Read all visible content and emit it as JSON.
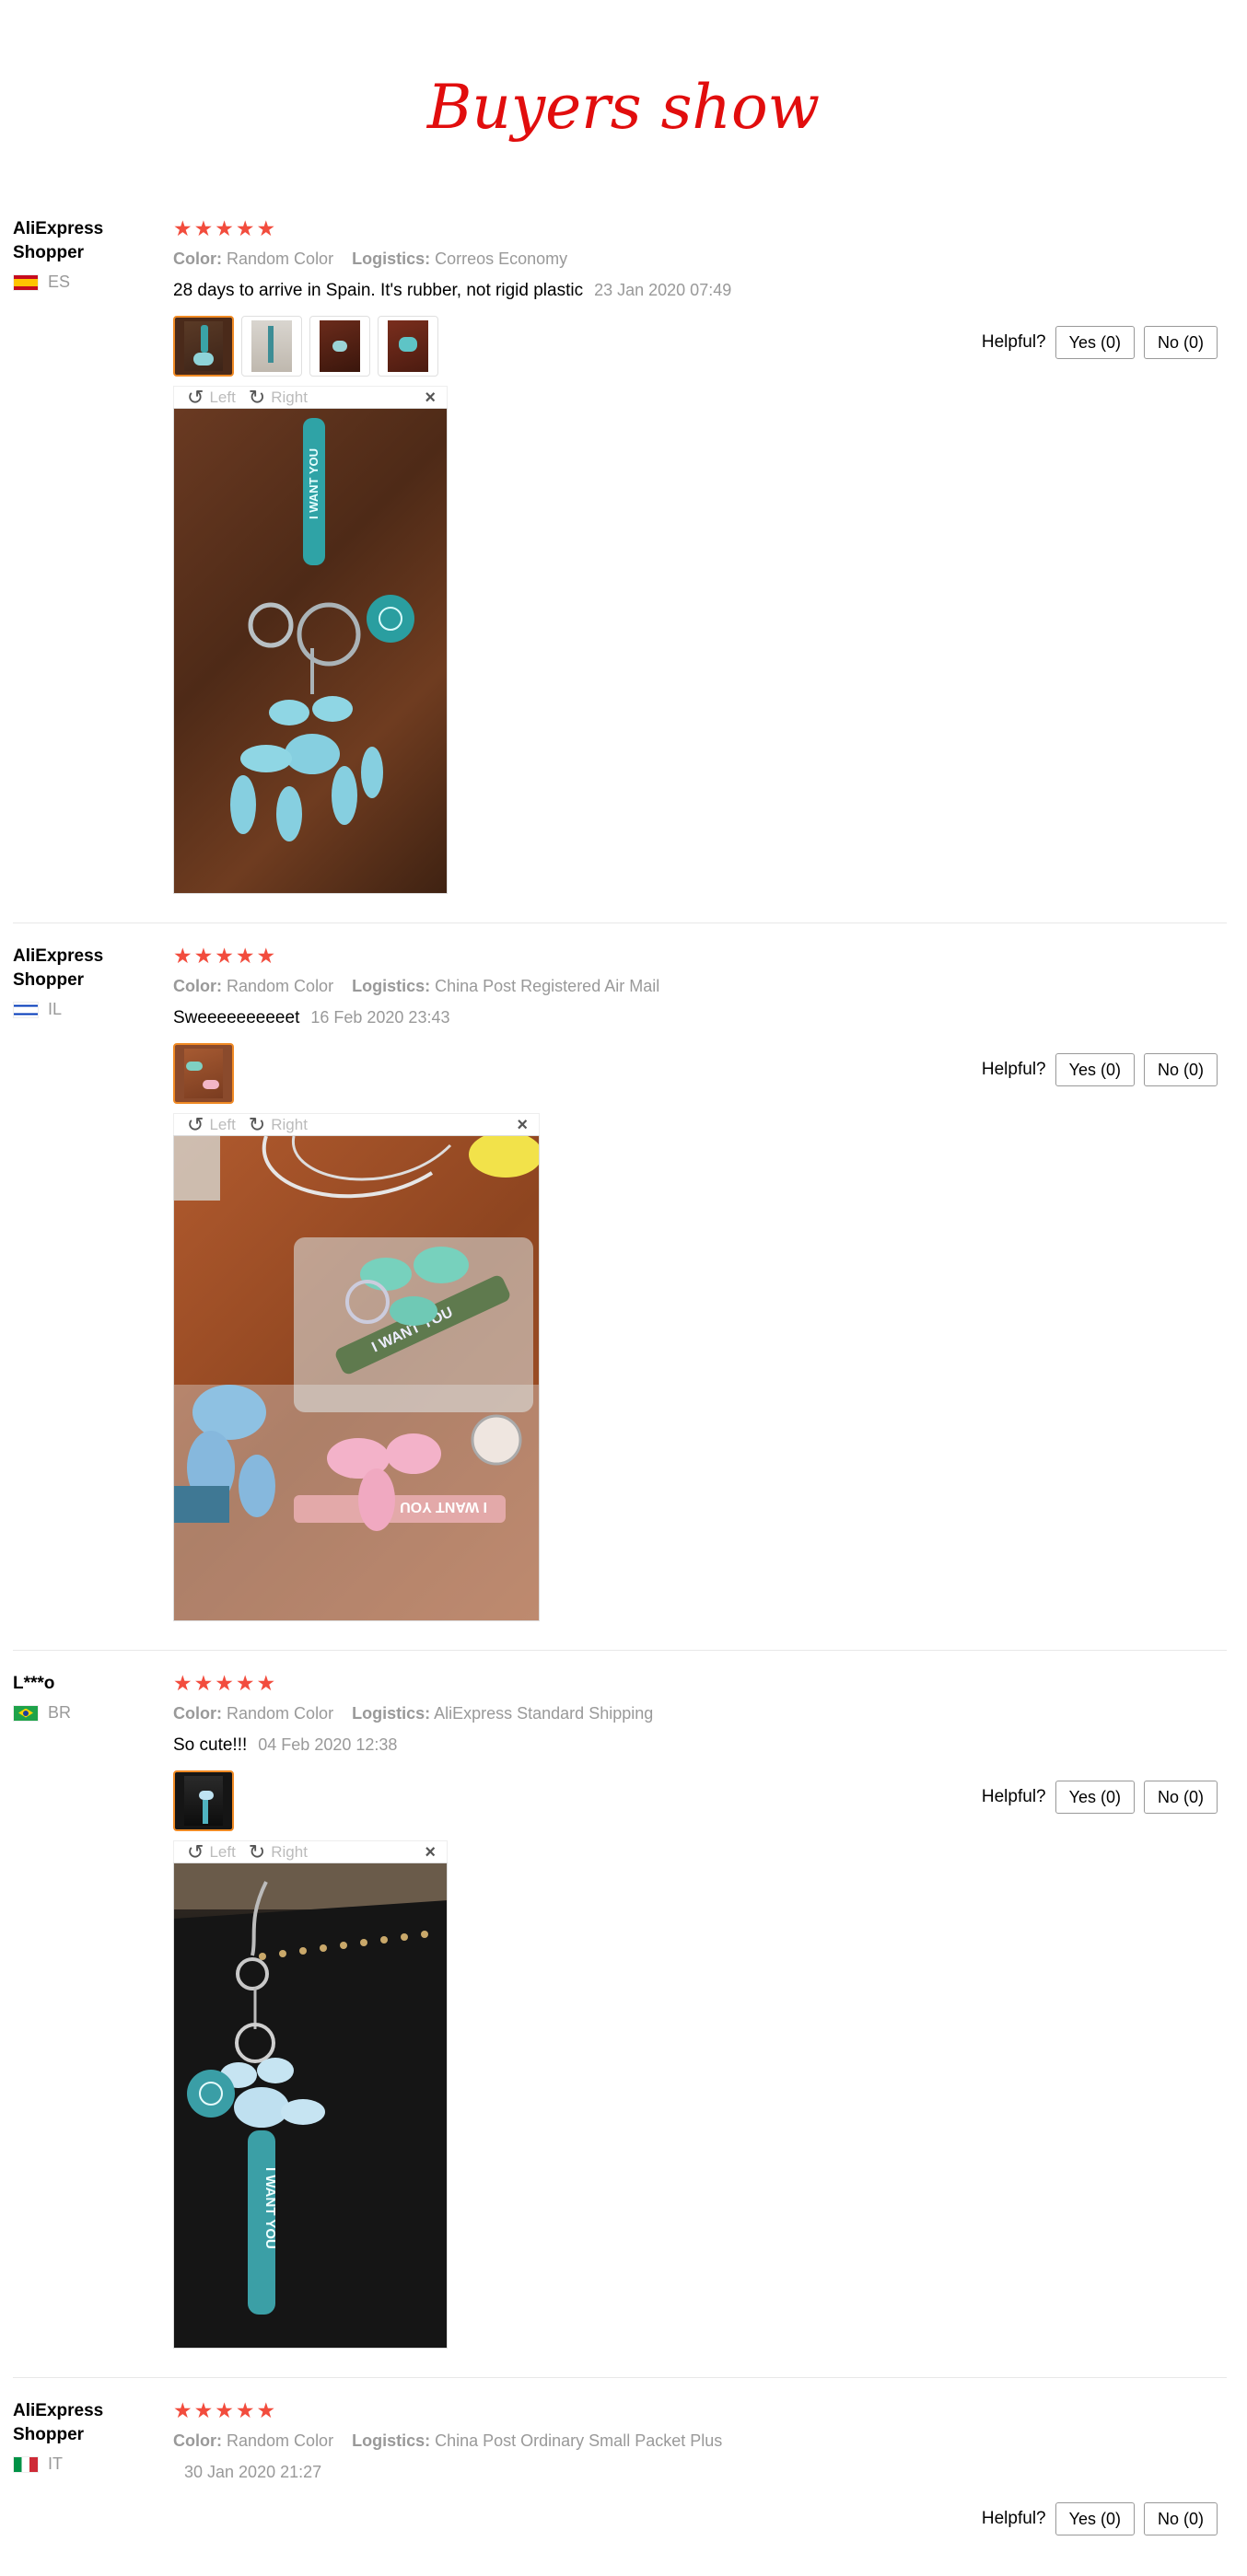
{
  "page": {
    "title": "Buyers show"
  },
  "icons": {
    "star": "star-icon",
    "rotate_left": "rotate-left-icon",
    "rotate_right": "rotate-right-icon",
    "close": "close-icon"
  },
  "colors": {
    "title": "#e10d0d",
    "star": "#f24c3d",
    "active_border": "#f08a24"
  },
  "labels": {
    "color": "Color:",
    "logistics": "Logistics:",
    "left": "Left",
    "right": "Right",
    "helpful": "Helpful?",
    "close": "×"
  },
  "reviews": [
    {
      "user": "AliExpress Shopper",
      "country": "ES",
      "rating": 5,
      "color": "Random Color",
      "logistics": "Correos Economy",
      "text": "28 days to arrive in Spain. It's rubber, not rigid plastic",
      "date": "23 Jan 2020 07:49",
      "yes": "Yes (0)",
      "no": "No (0)"
    },
    {
      "user": "AliExpress Shopper",
      "country": "IL",
      "rating": 5,
      "color": "Random Color",
      "logistics": "China Post Registered Air Mail",
      "text": "Sweeeeeeeeeet",
      "date": "16 Feb 2020 23:43",
      "yes": "Yes (0)",
      "no": "No (0)"
    },
    {
      "user": "L***o",
      "country": "BR",
      "rating": 5,
      "color": "Random Color",
      "logistics": "AliExpress Standard Shipping",
      "text": "So cute!!!",
      "date": "04 Feb 2020 12:38",
      "yes": "Yes (0)",
      "no": "No (0)"
    },
    {
      "user": "AliExpress Shopper",
      "country": "IT",
      "rating": 5,
      "color": "Random Color",
      "logistics": "China Post Ordinary Small Packet Plus",
      "text": "",
      "date": "30 Jan 2020 21:27",
      "yes": "Yes (0)",
      "no": "No (0)"
    }
  ]
}
